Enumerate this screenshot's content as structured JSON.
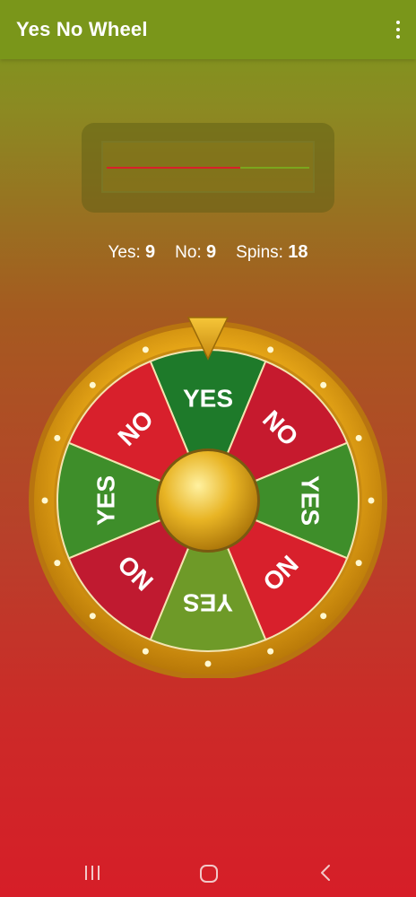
{
  "app": {
    "title": "Yes No Wheel",
    "menu_icon": "more-vert-icon"
  },
  "result": {
    "progress": 0.66,
    "colors": {
      "fill": "#d9202a",
      "track": "#7ba61e"
    }
  },
  "stats": {
    "yes_label": "Yes:",
    "yes_count": "9",
    "no_label": "No:",
    "no_count": "9",
    "spins_label": "Spins:",
    "spins_count": "18"
  },
  "wheel": {
    "pointer_icon": "pointer-triangle-icon",
    "segments": [
      {
        "label": "YES",
        "color": "#1e7a2a"
      },
      {
        "label": "NO",
        "color": "#c61a2e"
      },
      {
        "label": "YES",
        "color": "#3e8e2a"
      },
      {
        "label": "NO",
        "color": "#d8202c"
      },
      {
        "label": "YES",
        "color": "#6e9a28"
      },
      {
        "label": "NO",
        "color": "#c01a30"
      },
      {
        "label": "YES",
        "color": "#3e8e2a"
      },
      {
        "label": "NO",
        "color": "#d8202c"
      }
    ]
  },
  "navbar": {
    "recents_icon": "recents-icon",
    "home_icon": "home-icon",
    "back_icon": "back-icon"
  }
}
